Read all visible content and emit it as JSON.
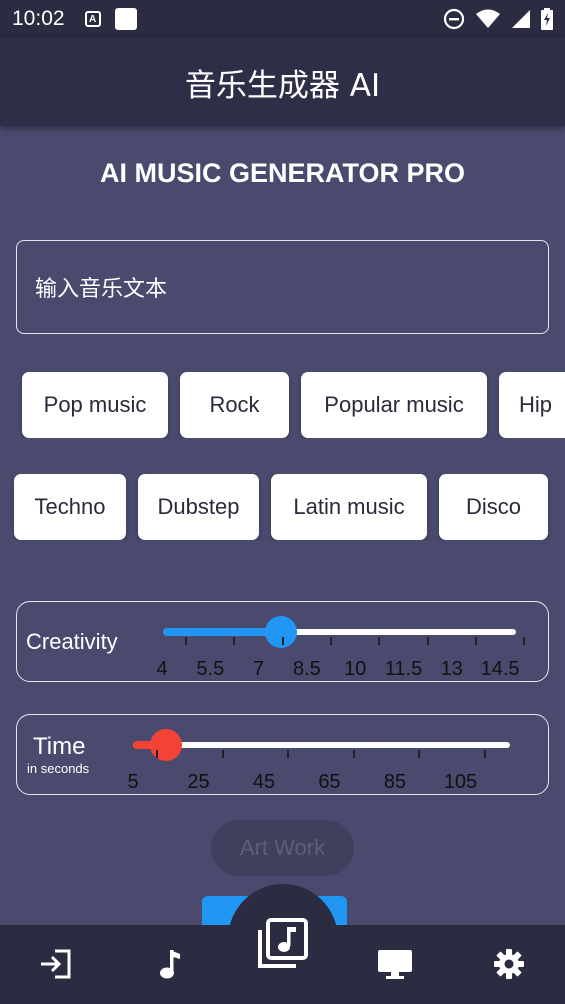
{
  "status_bar": {
    "time": "10:02",
    "a_icon": "A"
  },
  "app_bar": {
    "title": "音乐生成器 AI"
  },
  "heading": "AI MUSIC GENERATOR PRO",
  "input": {
    "placeholder": "输入音乐文本"
  },
  "genres_row1": [
    "Pop music",
    "Rock",
    "Popular music",
    "Hip"
  ],
  "genres_row2": [
    "Techno",
    "Dubstep",
    "Latin music",
    "Disco"
  ],
  "creativity": {
    "label": "Creativity",
    "value": 7.5,
    "min": 4,
    "max": 14.5,
    "ticks": [
      "4",
      "5.5",
      "7",
      "8.5",
      "10",
      "11.5",
      "13",
      "14.5"
    ],
    "color": "#2196f3"
  },
  "time": {
    "label": "Time",
    "sublabel": "in seconds",
    "value": 15,
    "min": 5,
    "max": 120,
    "ticks": [
      "5",
      "25",
      "45",
      "65",
      "85",
      "105"
    ],
    "color": "#f44336"
  },
  "art_button": "Art Work",
  "nav": {
    "items": [
      "login-icon",
      "music-note-icon",
      "music-library-icon",
      "desktop-icon",
      "settings-icon"
    ]
  }
}
